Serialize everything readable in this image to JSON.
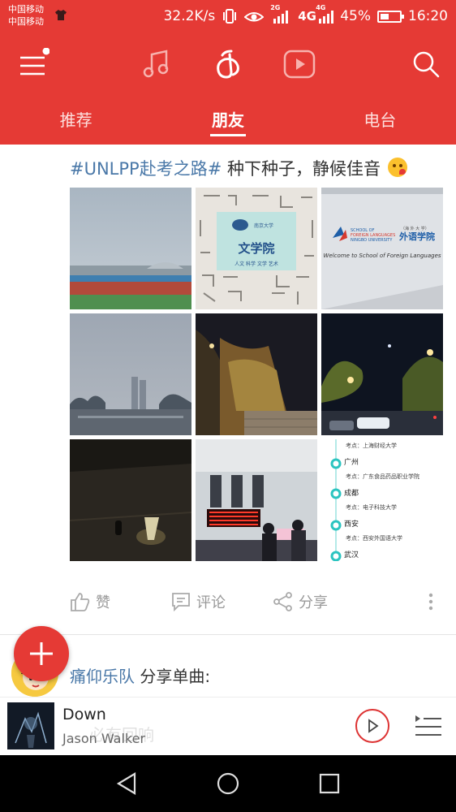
{
  "status_bar": {
    "carrier_1": "中国移动",
    "carrier_2": "中国移动",
    "net_speed": "32.2K/s",
    "net_2g": "2G",
    "net_4g_a": "4G",
    "net_4g_b": "4G",
    "battery": "45%",
    "battery_level": 0.45,
    "time": "16:20"
  },
  "colors": {
    "brand_red": "#e53a35",
    "hashtag_blue": "#4a78a8"
  },
  "top_nav": {
    "menu_icon": "hamburger-menu-icon",
    "music_icon": "music-note-icon",
    "home_icon": "netease-cloud-music-logo-icon",
    "video_icon": "video-play-icon",
    "search_icon": "search-icon"
  },
  "tabs": [
    {
      "label": "推荐",
      "active": false
    },
    {
      "label": "朋友",
      "active": true
    },
    {
      "label": "电台",
      "active": false
    }
  ],
  "post": {
    "hashtag": "#UNLPP赴考之路#",
    "text": "种下种子，静候佳音",
    "emoji": "kissing-face-emoji",
    "photos": [
      {
        "subject": "campus-stadium-photo"
      },
      {
        "subject": "school-of-liberal-arts-sign-photo",
        "sign_text": "文学院"
      },
      {
        "subject": "school-of-foreign-languages-wall-photo",
        "sign_text": "外语学院",
        "sign_text_en": "Welcome to School of Foreign Languages"
      },
      {
        "subject": "foggy-city-skyline-photo"
      },
      {
        "subject": "ivy-wall-night-photo"
      },
      {
        "subject": "street-at-night-photo"
      },
      {
        "subject": "dark-alley-photo"
      },
      {
        "subject": "train-station-hall-photo"
      },
      {
        "subject": "exam-route-timeline-image",
        "items": [
          {
            "note": "考点：上海财经大学",
            "city": ""
          },
          {
            "note": "",
            "city": "广州"
          },
          {
            "note": "考点：广东食品药品职业学院",
            "city": ""
          },
          {
            "note": "",
            "city": "成都"
          },
          {
            "note": "考点：电子科技大学",
            "city": ""
          },
          {
            "note": "",
            "city": "西安"
          },
          {
            "note": "考点：西安外国语大学",
            "city": ""
          },
          {
            "note": "",
            "city": "武汉"
          }
        ]
      }
    ],
    "actions": {
      "like": "赞",
      "comment": "评论",
      "share": "分享"
    }
  },
  "next_post": {
    "user": "痛仰乐队",
    "action": "分享单曲:",
    "avatar": "cartoon-avatar"
  },
  "player": {
    "title": "Down",
    "artist": "Jason Walker",
    "overlay_text": "必有回响"
  }
}
